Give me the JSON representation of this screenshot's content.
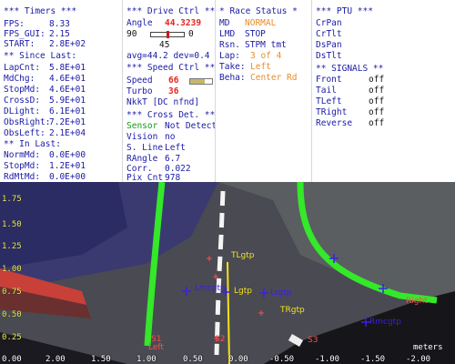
{
  "timers": {
    "title": "*** Timers ***",
    "fps_label": "FPS:",
    "fps_value": "8.33",
    "fps_gui_label": "FPS_GUI:",
    "fps_gui_value": "2.15",
    "start_label": "START:",
    "start_value": "2.8E+02",
    "since_last_title": "** Since Last:",
    "since_last": [
      {
        "label": "LapCnt:",
        "value": "5.8E+01"
      },
      {
        "label": "MdChg:",
        "value": "4.6E+01"
      },
      {
        "label": "StopMd:",
        "value": "4.6E+01"
      },
      {
        "label": "CrossD:",
        "value": "5.9E+01"
      },
      {
        "label": "DLight:",
        "value": "6.1E+01"
      },
      {
        "label": "ObsRight:",
        "value": "7.2E+01"
      },
      {
        "label": "ObsLeft:",
        "value": "2.1E+04"
      }
    ],
    "in_last_title": "** In Last:",
    "in_last": [
      {
        "label": "NormMd:",
        "value": "0.0E+00"
      },
      {
        "label": "StopMd:",
        "value": "1.2E+01"
      },
      {
        "label": "RdMtMd:",
        "value": "0.0E+00"
      }
    ]
  },
  "drive": {
    "title": "*** Drive Ctrl ***",
    "angle_label": "Angle",
    "angle_value": "44.3239",
    "slider_min": "90",
    "slider_max": "0",
    "slider_mid": "45",
    "slider_fraction": 0.5,
    "avg_dev": "avg=44.2 dev=0.4",
    "speed_title": "*** Speed Ctrl ***",
    "speed_label": "Speed",
    "speed_value": "66",
    "speed_fraction": 0.66,
    "turbo_label": "Turbo",
    "turbo_value": "36",
    "nkt_text": "NkkT [DC nfnd]",
    "cross_title": "*** Cross Det. ***",
    "cross_rows": [
      {
        "label": "Sensor",
        "value": "Not Detect."
      },
      {
        "label": "Vision",
        "value": "no"
      },
      {
        "label": "S. Line",
        "value": "Left"
      },
      {
        "label": "RAngle",
        "value": "6.7"
      },
      {
        "label": "Corr.",
        "value": "0.022"
      },
      {
        "label": "Pix Cnt",
        "value": "978"
      }
    ]
  },
  "race": {
    "title": "* Race Status *",
    "md_label": "MD",
    "md_value": "NORMAL",
    "lmd_label": "LMD",
    "lmd_value": "STOP",
    "rsn_label": "Rsn.",
    "rsn_value": "STPM tmt",
    "lap_label": "Lap:",
    "lap_value": "3 of 4",
    "take_label": "Take:",
    "take_value": "Left",
    "beha_label": "Beha:",
    "beha_value": "Center Rd"
  },
  "ptu": {
    "title": "*** PTU ***",
    "items": [
      "CrPan",
      "CrTlt",
      "DsPan",
      "DsTlt"
    ],
    "signals_title": "** SIGNALS **",
    "signals": [
      {
        "label": "Front",
        "value": "off"
      },
      {
        "label": "Tail",
        "value": "off"
      },
      {
        "label": "TLeft",
        "value": "off"
      },
      {
        "label": "TRight",
        "value": "off"
      },
      {
        "label": "Reverse",
        "value": "off"
      }
    ]
  },
  "camera": {
    "y_ticks": [
      "1.75",
      "1.50",
      "1.25",
      "1.00",
      "0.75",
      "0.50",
      "0.25",
      "0.00"
    ],
    "x_ticks": [
      "2.00",
      "1.50",
      "1.00",
      "0.50",
      "0.00",
      "-0.50",
      "-1.00",
      "-1.50",
      "-2.00"
    ],
    "units": "meters",
    "labels": {
      "tlgtp": "TLgtp",
      "lmcgtp": "Lmcgtp",
      "lgtp": "Lgtp",
      "lrgtp": "Lrgtp",
      "trgtp": "TRgtp",
      "rmcgtp": "Rmcgtp",
      "right": "Right",
      "left": "Left",
      "s1": "S1",
      "s2": "S2",
      "s3": "S3"
    },
    "colors": {
      "lane_green": "#34e82a",
      "yellow_line": "#f2e21a",
      "marker_blue": "#3a1fe6",
      "marker_red": "#ff4c4c"
    }
  }
}
